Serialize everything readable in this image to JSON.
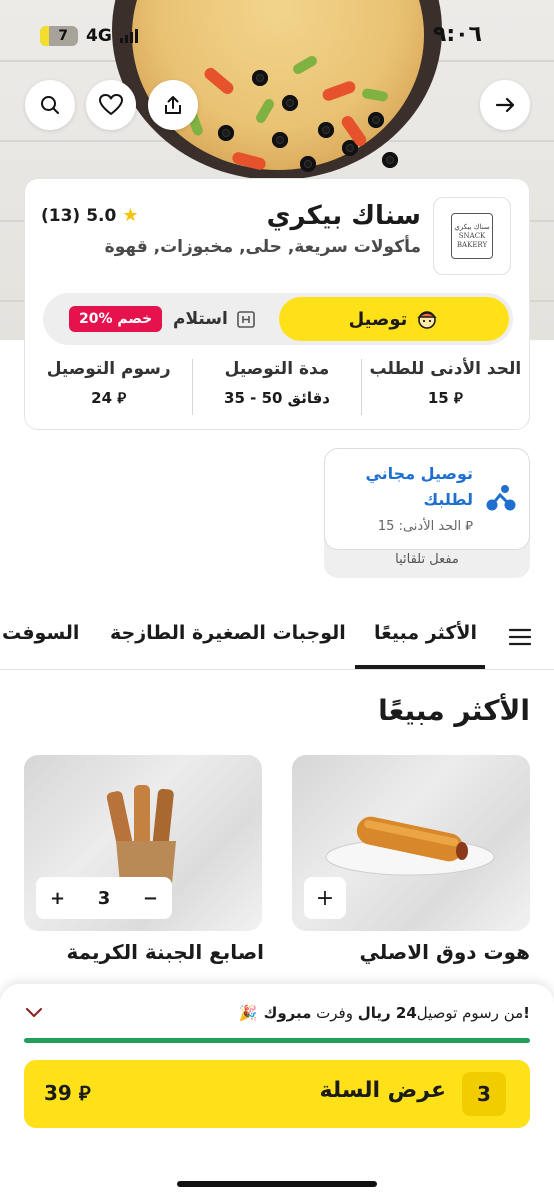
{
  "status_bar": {
    "time": "٩:٠٦",
    "battery": "7",
    "network": "4G"
  },
  "store": {
    "name": "سناك بيكري",
    "categories": "مأكولات سريعة, حلى, مخبوزات, قهوة",
    "rating": "5.0",
    "rating_count": "(13)",
    "logo_text_ar": "سناك بيكري",
    "logo_text_en_1": "SNACK",
    "logo_text_en_2": "BAKERY"
  },
  "order_mode": {
    "delivery": "توصيل",
    "pickup": "استلام",
    "discount": "20% خصم"
  },
  "stats": [
    {
      "label": "الحد الأدنى للطلب",
      "value": "15 ⃁"
    },
    {
      "label": "مدة التوصيل",
      "value": "35 - 50 دقائق"
    },
    {
      "label": "رسوم التوصيل",
      "value": "24 ⃁"
    }
  ],
  "free_delivery": {
    "title": "توصيل مجاني لطلبك",
    "min": "الحد الأدنى: 15 ⃁",
    "auto": "مفعل تلقائيا"
  },
  "tabs": [
    "الأكثر مبيعًا",
    "الوجبات الصغيرة الطازجة",
    "السوفت"
  ],
  "section_title": "الأكثر مبيعًا",
  "products": [
    {
      "name": "هوت دوق الاصلي"
    },
    {
      "name": "اصابع الجبنة الكريمة",
      "qty": "3"
    }
  ],
  "cart": {
    "congrats_bold": "مبروك!",
    "congrats_mid": " وفرت ",
    "congrats_amount": "24 ريال",
    "congrats_rest": " من رسوم توصيل",
    "celebrate_icon": "🎉",
    "progress": 1.0,
    "count": "3",
    "label": "عرض السلة",
    "total": "39 ⃁"
  },
  "colors": {
    "accent": "#ffe11a",
    "discount": "#e6124d",
    "link": "#1f6fd1",
    "progress": "#22a05a"
  }
}
